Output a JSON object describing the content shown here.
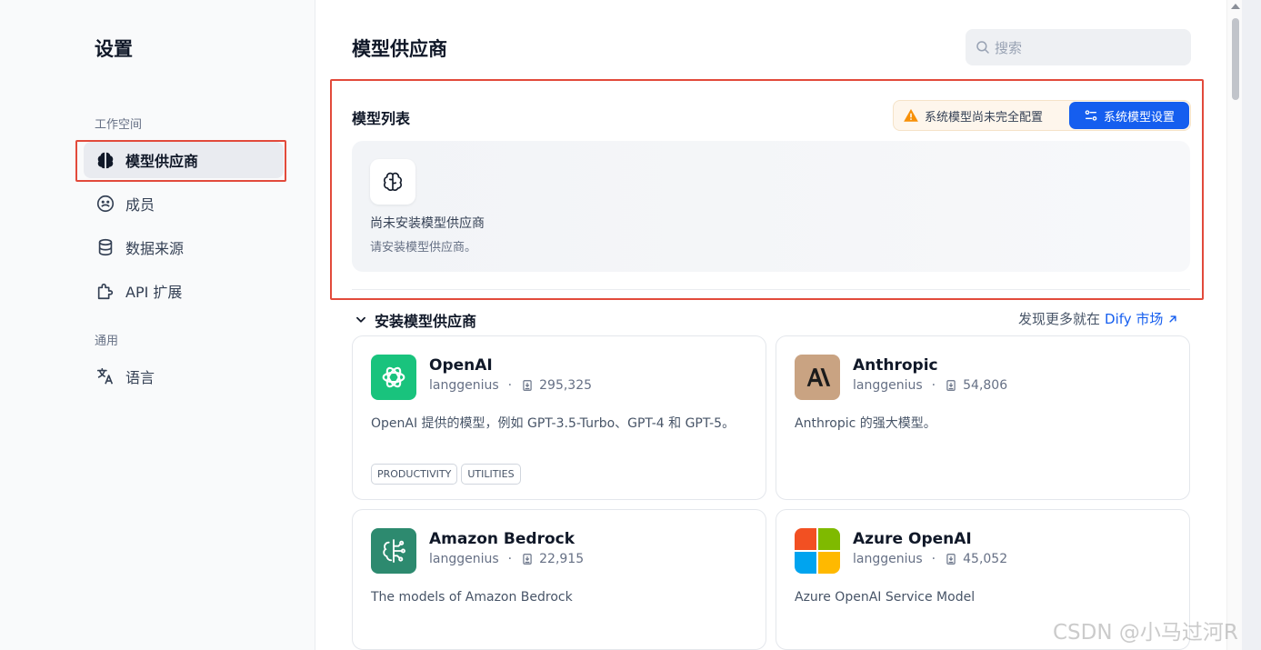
{
  "sidebar": {
    "title": "设置",
    "groups": {
      "workspace": "工作空间",
      "general": "通用"
    },
    "items": [
      {
        "label": "模型供应商",
        "icon": "brain-icon",
        "active": true
      },
      {
        "label": "成员",
        "icon": "members-icon",
        "active": false
      },
      {
        "label": "数据来源",
        "icon": "database-icon",
        "active": false
      },
      {
        "label": "API 扩展",
        "icon": "puzzle-icon",
        "active": false
      },
      {
        "label": "语言",
        "icon": "translate-icon",
        "active": false
      }
    ]
  },
  "header": {
    "title": "模型供应商",
    "search_placeholder": "搜索"
  },
  "model_list": {
    "title": "模型列表",
    "warning": "系统模型尚未完全配置",
    "settings_button": "系统模型设置",
    "empty_title": "尚未安装模型供应商",
    "empty_subtitle": "请安装模型供应商。"
  },
  "install": {
    "title": "安装模型供应商",
    "market_prefix": "发现更多就在",
    "market_link": "Dify 市场"
  },
  "providers": [
    {
      "name": "OpenAI",
      "author": "langgenius",
      "installs": "295,325",
      "description": "OpenAI 提供的模型，例如 GPT-3.5-Turbo、GPT-4 和 GPT-5。",
      "tags": [
        "PRODUCTIVITY",
        "UTILITIES"
      ],
      "logo_color": "#19c37d"
    },
    {
      "name": "Anthropic",
      "author": "langgenius",
      "installs": "54,806",
      "description": "Anthropic 的强大模型。",
      "tags": [],
      "logo_color": "#c9a382"
    },
    {
      "name": "Amazon Bedrock",
      "author": "langgenius",
      "installs": "22,915",
      "description": "The models of Amazon Bedrock",
      "tags": [],
      "logo_color": "#2d8a6f"
    },
    {
      "name": "Azure OpenAI",
      "author": "langgenius",
      "installs": "45,052",
      "description": "Azure OpenAI Service Model",
      "tags": [],
      "logo_color": "#f25022"
    }
  ],
  "watermark": "CSDN @小马过河R",
  "colors": {
    "accent": "#155eef",
    "highlight": "#e24a3b",
    "warning": "#f79009"
  }
}
